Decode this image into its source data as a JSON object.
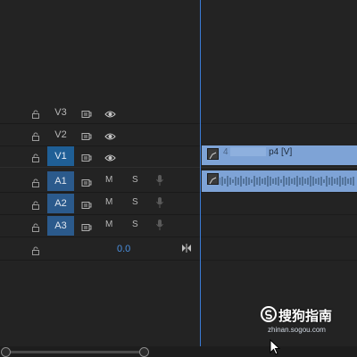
{
  "tracks": {
    "video": [
      {
        "name": "V3",
        "active": false
      },
      {
        "name": "V2",
        "active": false
      },
      {
        "name": "V1",
        "active": true
      }
    ],
    "audio": [
      {
        "name": "A1",
        "active": true,
        "mute": "M",
        "solo": "S"
      },
      {
        "name": "A2",
        "active": true,
        "mute": "M",
        "solo": "S"
      },
      {
        "name": "A3",
        "active": true,
        "mute": "M",
        "solo": "S"
      }
    ],
    "master": {
      "volume": "0.0"
    }
  },
  "clip": {
    "video_label": "p4 [V]",
    "obscured_prefix": "4"
  },
  "watermark": {
    "brand": "搜狗指南",
    "site": "zhinan.sogou.com"
  },
  "colors": {
    "accent": "#3a7bd5",
    "clip": "#7ea3d6",
    "track_active": "#1f5f96",
    "background": "#232323"
  },
  "icons": [
    "lock-icon",
    "output-icon",
    "eye-icon",
    "mic-icon",
    "expand-icon"
  ]
}
